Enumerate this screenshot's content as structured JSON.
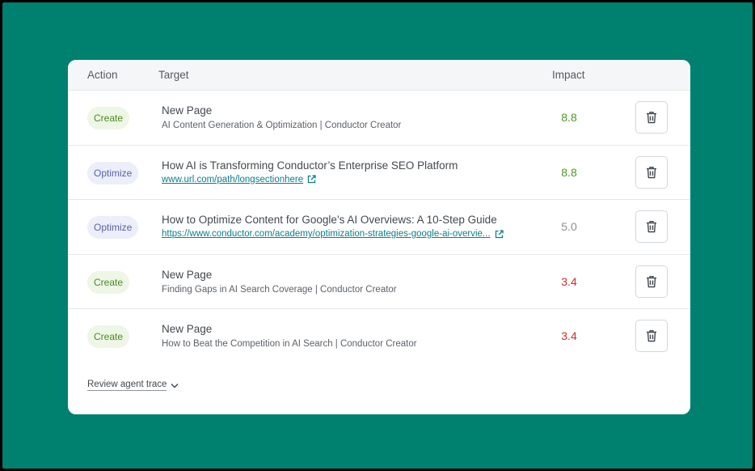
{
  "colors": {
    "background": "#00806e",
    "impact_high": "#4a9a1f",
    "impact_mid": "#8a8f94",
    "impact_low": "#d12c2c",
    "create_badge_text": "#4a8a1d",
    "optimize_badge_text": "#5a63a6",
    "link": "#0c7e88"
  },
  "header": {
    "action": "Action",
    "target": "Target",
    "impact": "Impact"
  },
  "rows": [
    {
      "action": "Create",
      "title": "New Page",
      "subtitle": "AI Content Generation & Optimization | Conductor Creator",
      "impact": "8.8",
      "impact_level": "high",
      "icons": [
        "trash-icon"
      ]
    },
    {
      "action": "Optimize",
      "title": "How AI is Transforming Conductor’s Enterprise SEO Platform",
      "url": "www.url.com/path/longsectionhere",
      "impact": "8.8",
      "impact_level": "high",
      "icons": [
        "external-link-icon",
        "trash-icon"
      ]
    },
    {
      "action": "Optimize",
      "title": "How to Optimize Content for Google’s AI Overviews: A 10-Step Guide",
      "url": "https://www.conductor.com/academy/optimization-strategies-google-ai-overvie...",
      "impact": "5.0",
      "impact_level": "mid",
      "icons": [
        "external-link-icon",
        "trash-icon"
      ]
    },
    {
      "action": "Create",
      "title": "New Page",
      "subtitle": "Finding Gaps in AI Search Coverage | Conductor Creator",
      "impact": "3.4",
      "impact_level": "low",
      "icons": [
        "trash-icon"
      ]
    },
    {
      "action": "Create",
      "title": "New Page",
      "subtitle": "How to Beat the Competition in AI Search | Conductor Creator",
      "impact": "3.4",
      "impact_level": "low",
      "icons": [
        "trash-icon"
      ]
    }
  ],
  "footer": {
    "trace_label": "Review agent trace",
    "icon": "chevron-down-icon"
  }
}
